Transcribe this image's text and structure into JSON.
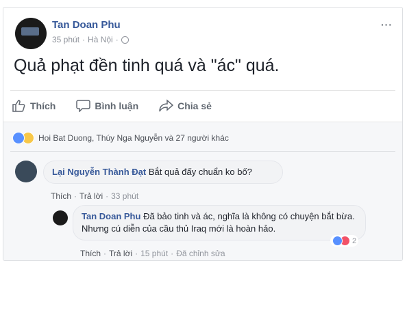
{
  "post": {
    "author": "Tan Doan Phu",
    "time": "35 phút",
    "location": "Hà Nội",
    "text": "Quả phạt đền tinh quá và \"ác\" quá.",
    "more_icon": "···"
  },
  "actions": {
    "like": "Thích",
    "comment": "Bình luận",
    "share": "Chia sẻ"
  },
  "reactions": {
    "summary": "Hoi Bat Duong, Thúy Nga Nguyễn và 27 người khác"
  },
  "comments": [
    {
      "author": "Lại Nguyễn Thành Đạt",
      "text": "Bắt quả đấy chuẩn ko bố?",
      "like": "Thích",
      "reply": "Trả lời",
      "time": "33 phút"
    },
    {
      "author": "Tan Doan Phu",
      "text": "Đã bảo tinh và ác, nghĩa là không có chuyện bắt bừa. Nhưng cú diễn của cầu thủ Iraq mới là hoàn hảo.",
      "like": "Thích",
      "reply": "Trả lời",
      "time": "15 phút",
      "edited": "Đã chỉnh sửa",
      "reaction_count": "2"
    }
  ],
  "sep": "·",
  "colors": {
    "link": "#365899",
    "secondary": "#90949c",
    "like_blue": "#5890ff"
  }
}
